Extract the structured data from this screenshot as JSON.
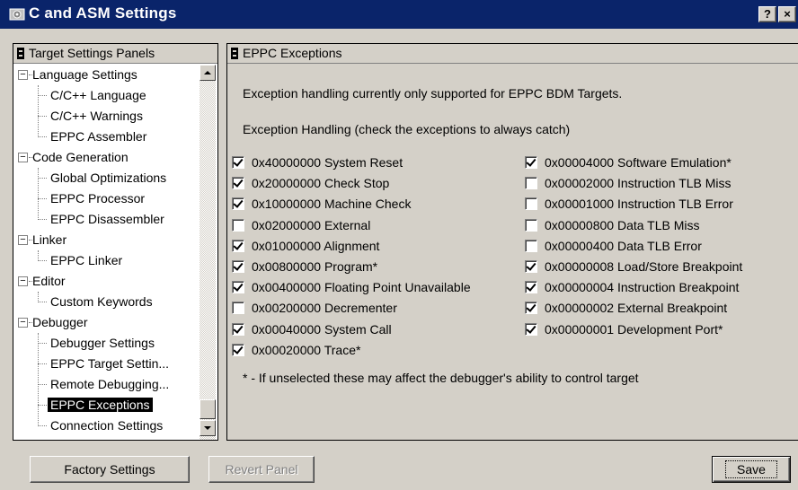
{
  "window": {
    "title": "C and ASM Settings",
    "help_label": "?",
    "close_label": "×",
    "icon": "settings-app-icon"
  },
  "tree": {
    "header": "Target Settings Panels",
    "groups": [
      {
        "label": "Language Settings",
        "expander": "−",
        "items": [
          "C/C++ Language",
          "C/C++ Warnings",
          "EPPC Assembler"
        ]
      },
      {
        "label": "Code Generation",
        "expander": "−",
        "items": [
          "Global Optimizations",
          "EPPC Processor",
          "EPPC Disassembler"
        ]
      },
      {
        "label": "Linker",
        "expander": "−",
        "items": [
          "EPPC Linker"
        ]
      },
      {
        "label": "Editor",
        "expander": "−",
        "items": [
          "Custom Keywords"
        ]
      },
      {
        "label": "Debugger",
        "expander": "−",
        "items": [
          "Debugger Settings",
          "EPPC Target Settin...",
          "Remote Debugging...",
          "EPPC Exceptions",
          "Connection Settings"
        ]
      }
    ],
    "selected": "EPPC Exceptions"
  },
  "panel": {
    "header": "EPPC Exceptions",
    "note": "Exception handling currently only supported for EPPC BDM Targets.",
    "subtitle": "Exception Handling (check the exceptions to always catch)",
    "left_column": [
      {
        "label": "0x40000000 System Reset",
        "checked": true
      },
      {
        "label": "0x20000000 Check Stop",
        "checked": true
      },
      {
        "label": "0x10000000 Machine Check",
        "checked": true
      },
      {
        "label": "0x02000000 External",
        "checked": false
      },
      {
        "label": "0x01000000 Alignment",
        "checked": true
      },
      {
        "label": "0x00800000 Program*",
        "checked": true
      },
      {
        "label": "0x00400000 Floating Point Unavailable",
        "checked": true
      },
      {
        "label": "0x00200000 Decrementer",
        "checked": false
      },
      {
        "label": "0x00040000 System Call",
        "checked": true
      },
      {
        "label": "0x00020000 Trace*",
        "checked": true
      }
    ],
    "right_column": [
      {
        "label": "0x00004000 Software Emulation*",
        "checked": true
      },
      {
        "label": "0x00002000 Instruction TLB Miss",
        "checked": false
      },
      {
        "label": "0x00001000 Instruction TLB Error",
        "checked": false
      },
      {
        "label": "0x00000800 Data TLB Miss",
        "checked": false
      },
      {
        "label": "0x00000400 Data TLB Error",
        "checked": false
      },
      {
        "label": "0x00000008 Load/Store Breakpoint",
        "checked": true
      },
      {
        "label": "0x00000004 Instruction Breakpoint",
        "checked": true
      },
      {
        "label": "0x00000002 External Breakpoint",
        "checked": true
      },
      {
        "label": "0x00000001 Development Port*",
        "checked": true
      }
    ],
    "footnote": "* - If unselected these may affect the debugger's ability to control target"
  },
  "buttons": {
    "factory": "Factory Settings",
    "revert": "Revert Panel",
    "save": "Save"
  }
}
